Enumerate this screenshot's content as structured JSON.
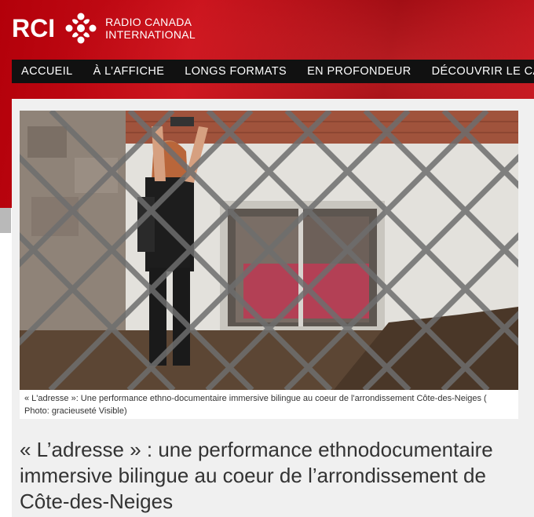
{
  "brand": {
    "logo_letters": "RCI",
    "name_line1": "RADIO CANADA",
    "name_line2": "INTERNATIONAL",
    "logo_icon": "cbc-gem-icon",
    "brand_color": "#c8101a"
  },
  "nav": {
    "items": [
      {
        "label": "ACCUEIL"
      },
      {
        "label": "À L’AFFICHE"
      },
      {
        "label": "LONGS FORMATS"
      },
      {
        "label": "EN PROFONDEUR"
      },
      {
        "label": "DÉCOUVRIR LE CANADA"
      }
    ]
  },
  "article": {
    "photo_caption": "« L'adresse »: Une performance ethno-documentaire immersive bilingue au coeur de l'arrondissement Côte-des-Neiges ( Photo: gracieuseté Visible)",
    "headline": "« L’adresse » : une performance ethnodocumentaire immersive bilingue au coeur de l’arrondissement de Côte-des-Neiges"
  }
}
